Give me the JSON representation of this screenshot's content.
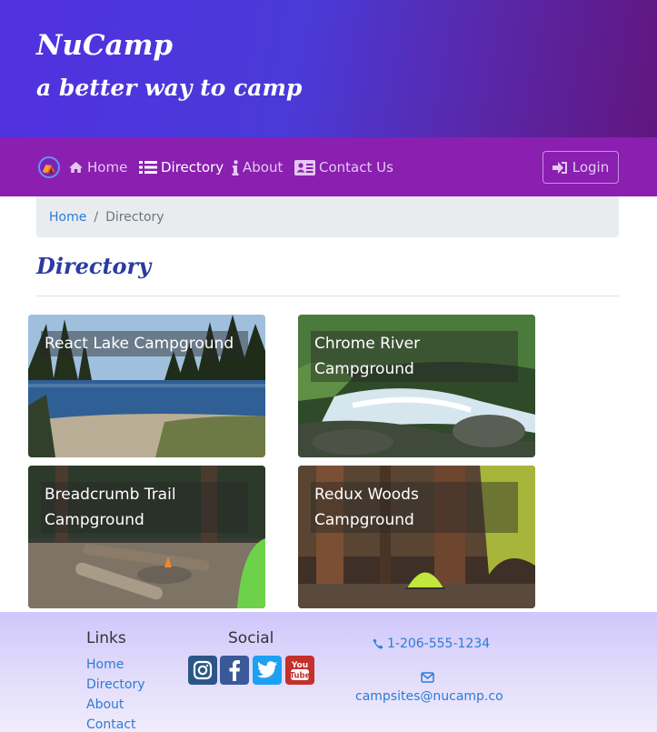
{
  "header": {
    "brand": "NuCamp",
    "tagline": "a better way to camp"
  },
  "nav": {
    "items": [
      {
        "label": "Home",
        "icon": "home-icon"
      },
      {
        "label": "Directory",
        "icon": "list-icon",
        "active": true
      },
      {
        "label": "About",
        "icon": "info-icon"
      },
      {
        "label": "Contact Us",
        "icon": "address-card-icon"
      }
    ],
    "login_label": "Login"
  },
  "breadcrumb": {
    "home": "Home",
    "current": "Directory"
  },
  "page": {
    "title": "Directory"
  },
  "campsites": [
    {
      "name": "React Lake Campground"
    },
    {
      "name": "Chrome River Campground"
    },
    {
      "name": "Breadcrumb Trail Campground"
    },
    {
      "name": "Redux Woods Campground"
    }
  ],
  "footer": {
    "links_heading": "Links",
    "links": [
      "Home",
      "Directory",
      "About",
      "Contact"
    ],
    "social_heading": "Social",
    "social": [
      "instagram-icon",
      "facebook-icon",
      "twitter-icon",
      "youtube-icon"
    ],
    "phone": "1-206-555-1234",
    "email": "campsites@nucamp.co"
  },
  "colors": {
    "navbar": "#8a1fb0",
    "link": "#2b7bd6",
    "title": "#2c3aa0"
  }
}
